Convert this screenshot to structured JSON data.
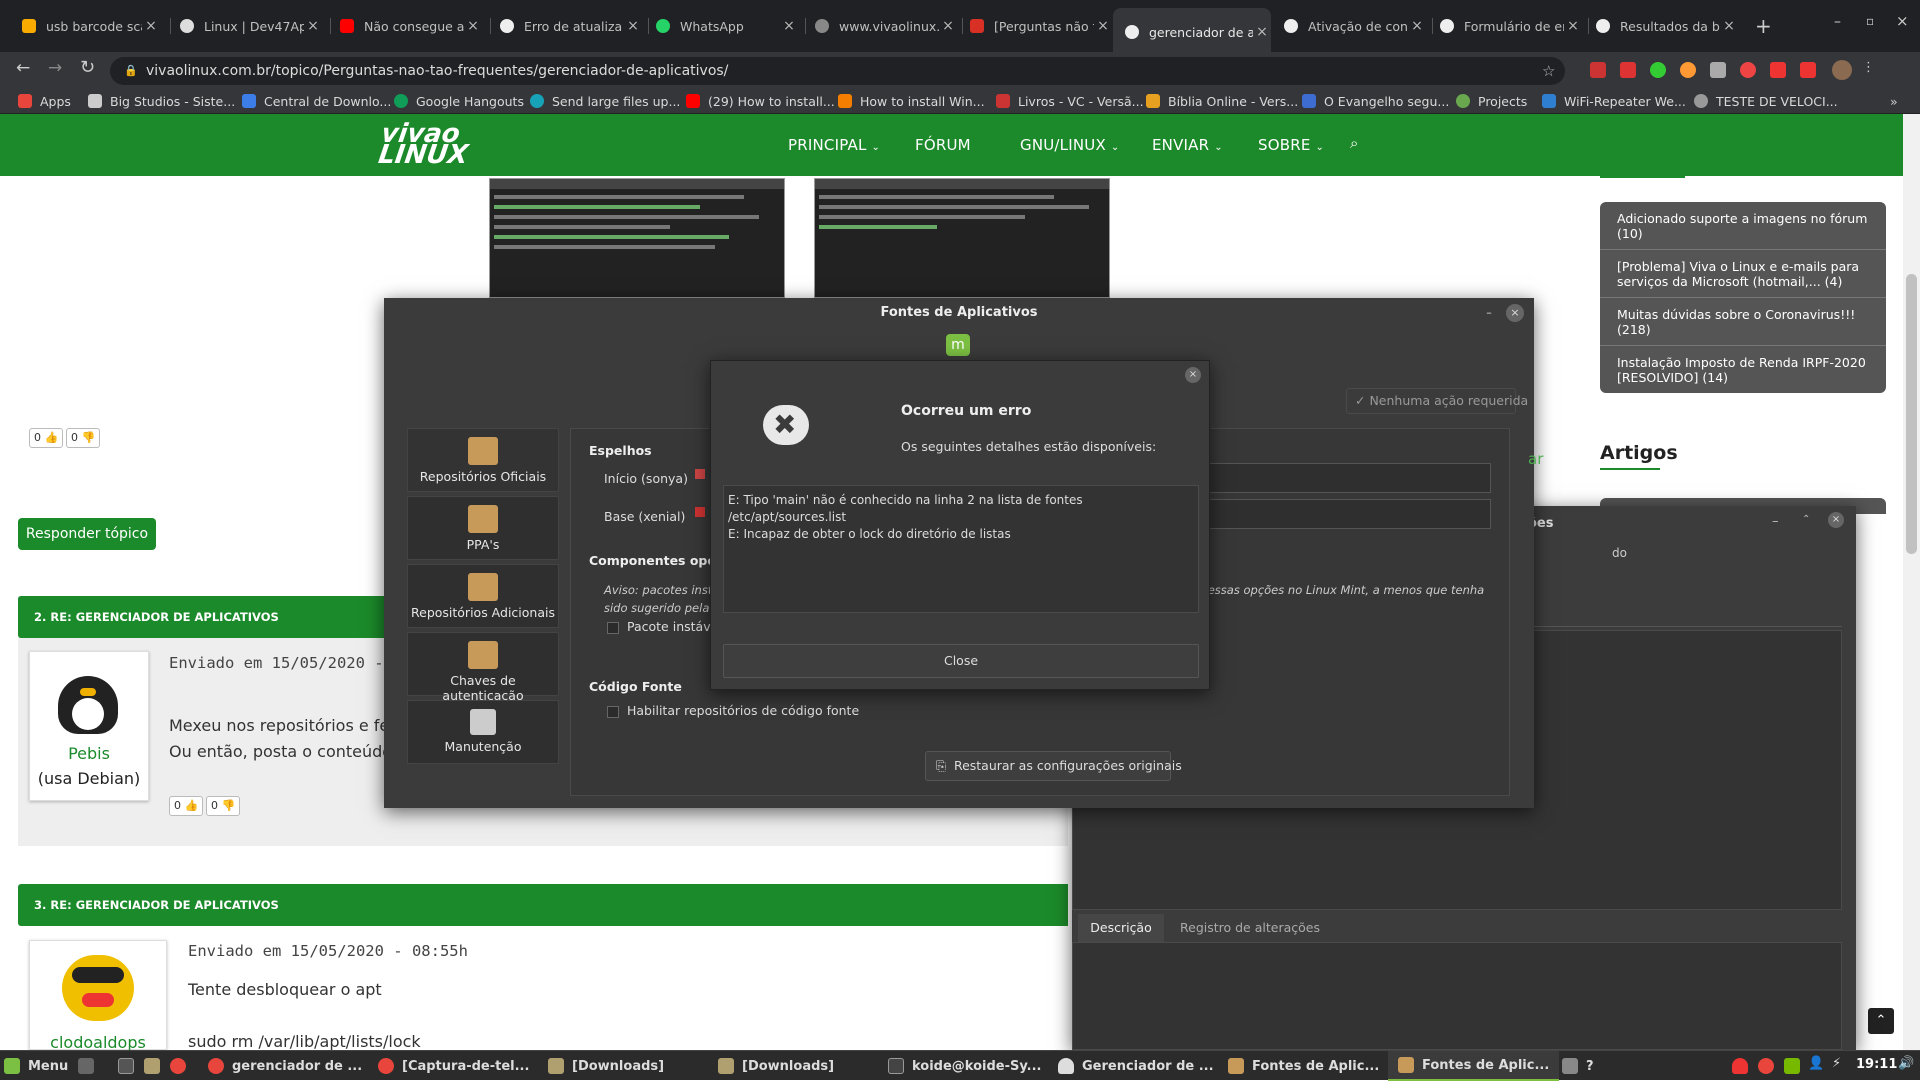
{
  "browser": {
    "tabs": [
      {
        "title": "usb barcode sca",
        "color": "#f9ab00"
      },
      {
        "title": "Linux | Dev47Ap",
        "color": "#ffffff"
      },
      {
        "title": "Não consegue a",
        "color": "#ff0000"
      },
      {
        "title": "Erro de atualiza",
        "color": "#eeeeee"
      },
      {
        "title": "WhatsApp",
        "color": "#25d366"
      },
      {
        "title": "www.vivaolinux.",
        "color": "#888888"
      },
      {
        "title": "[Perguntas não f",
        "color": "#d93025"
      },
      {
        "title": "gerenciador de a",
        "color": "#eeeeee"
      },
      {
        "title": "Ativação de con",
        "color": "#eeeeee"
      },
      {
        "title": "Formulário de er",
        "color": "#eeeeee"
      },
      {
        "title": "Resultados da bu",
        "color": "#eeeeee"
      }
    ],
    "url": "vivaolinux.com.br/topico/Perguntas-nao-tao-frequentes/gerenciador-de-aplicativos/",
    "bookmarks": [
      {
        "label": "Apps",
        "color": "#e8453c"
      },
      {
        "label": "Big Studios - Siste...",
        "color": "#cccccc"
      },
      {
        "label": "Central de Downlo...",
        "color": "#3d7de8"
      },
      {
        "label": "Google Hangouts",
        "color": "#0f9d58"
      },
      {
        "label": "Send large files up...",
        "color": "#17a2b8"
      },
      {
        "label": "(29) How to install...",
        "color": "#ff0000"
      },
      {
        "label": "How to install Win...",
        "color": "#f57d00"
      },
      {
        "label": "Livros - VC - Versã...",
        "color": "#cc3333"
      },
      {
        "label": "Bíblia Online - Vers...",
        "color": "#e8a020"
      },
      {
        "label": "O Evangelho segu...",
        "color": "#3d6dd0"
      },
      {
        "label": "Projects",
        "color": "#6aa84f"
      },
      {
        "label": "WiFi-Repeater We...",
        "color": "#2f7fd0"
      },
      {
        "label": "TESTE DE VELOCI...",
        "color": "#999999"
      }
    ]
  },
  "site": {
    "nav": [
      "PRINCIPAL",
      "FÓRUM",
      "GNU/LINUX",
      "ENVIAR",
      "SOBRE"
    ],
    "logo": "viva o linux",
    "like_up": "0",
    "like_down": "0",
    "reply_button": "Responder tópico",
    "posts": [
      {
        "header": "2. RE: GERENCIADOR DE APLICATIVOS",
        "date": "Enviado em 15/05/2020 -",
        "user": "Pebis",
        "distro": "(usa Debian)",
        "body1": "Mexeu nos repositórios e fez",
        "body2": "Ou então, posta o conteúdo d"
      },
      {
        "header": "3. RE: GERENCIADOR DE APLICATIVOS",
        "date": "Enviado em 15/05/2020 - 08:55h",
        "user": "clodoaldops",
        "body1": "Tente desbloquear o apt",
        "body2": "sudo rm /var/lib/apt/lists/lock"
      }
    ],
    "sidebar_items": [
      "Adicionado suporte a imagens no fórum (10)",
      "[Problema] Viva o Linux e e-mails para serviços da Microsoft (hotmail,... (4)",
      "Muitas dúvidas sobre o Coronavirus!!! (218)",
      "Instalação Imposto de Renda IRPF-2020 [RESOLVIDO] (14)"
    ],
    "sidebar_heading": "Artigos"
  },
  "sources_window": {
    "title": "Fontes de Aplicativos",
    "status": "Nenhuma ação requerida",
    "sidebar": [
      "Repositórios Oficiais",
      "PPA's",
      "Repositórios Adicionais",
      "Chaves de autenticação",
      "Manutenção"
    ],
    "mirrors_heading": "Espelhos",
    "mirror1": "Início (sonya)",
    "mirror2": "Base (xenial)",
    "components_heading": "Componentes opcio",
    "warning": "Aviso: pacotes instá",
    "warning2": "sido sugerido pela c",
    "warning_right": "e essas opções no Linux Mint, a menos que tenha",
    "unstable": "Pacote instáve",
    "source_heading": "Código Fonte",
    "source_checkbox": "Habilitar repositórios de código fonte",
    "restore": "Restaurar as configurações originais",
    "partial_link": "ar"
  },
  "error_dialog": {
    "title": "Ocorreu um erro",
    "subtitle": "Os seguintes detalhes estão disponíveis:",
    "line1": "E: Tipo 'main' não é conhecido na linha 2 na lista de fontes /etc/apt/sources.list",
    "line2": "E: Incapaz de obter o lock do diretório de listas",
    "close": "Close"
  },
  "back_window": {
    "title_fragment": "ões",
    "fragment2": "do",
    "tabs": [
      "Descrição",
      "Registro de alterações"
    ]
  },
  "taskbar": {
    "menu": "Menu",
    "items": [
      {
        "label": "gerenciador de ...",
        "color": "#e8453c"
      },
      {
        "label": "[Captura-de-tel...",
        "color": "#e8453c"
      },
      {
        "label": "[Downloads]",
        "color": "#b0a070"
      },
      {
        "label": "[Downloads]",
        "color": "#b0a070"
      },
      {
        "label": "koide@koide-Sy...",
        "color": "#444444"
      },
      {
        "label": "Gerenciador de ...",
        "color": "#dddddd"
      },
      {
        "label": "Fontes de Aplic...",
        "color": "#c89a5a"
      },
      {
        "label": "Fontes de Aplic...",
        "color": "#c89a5a"
      },
      {
        "label": "?",
        "color": "#888888"
      }
    ],
    "clock": "19:11"
  }
}
